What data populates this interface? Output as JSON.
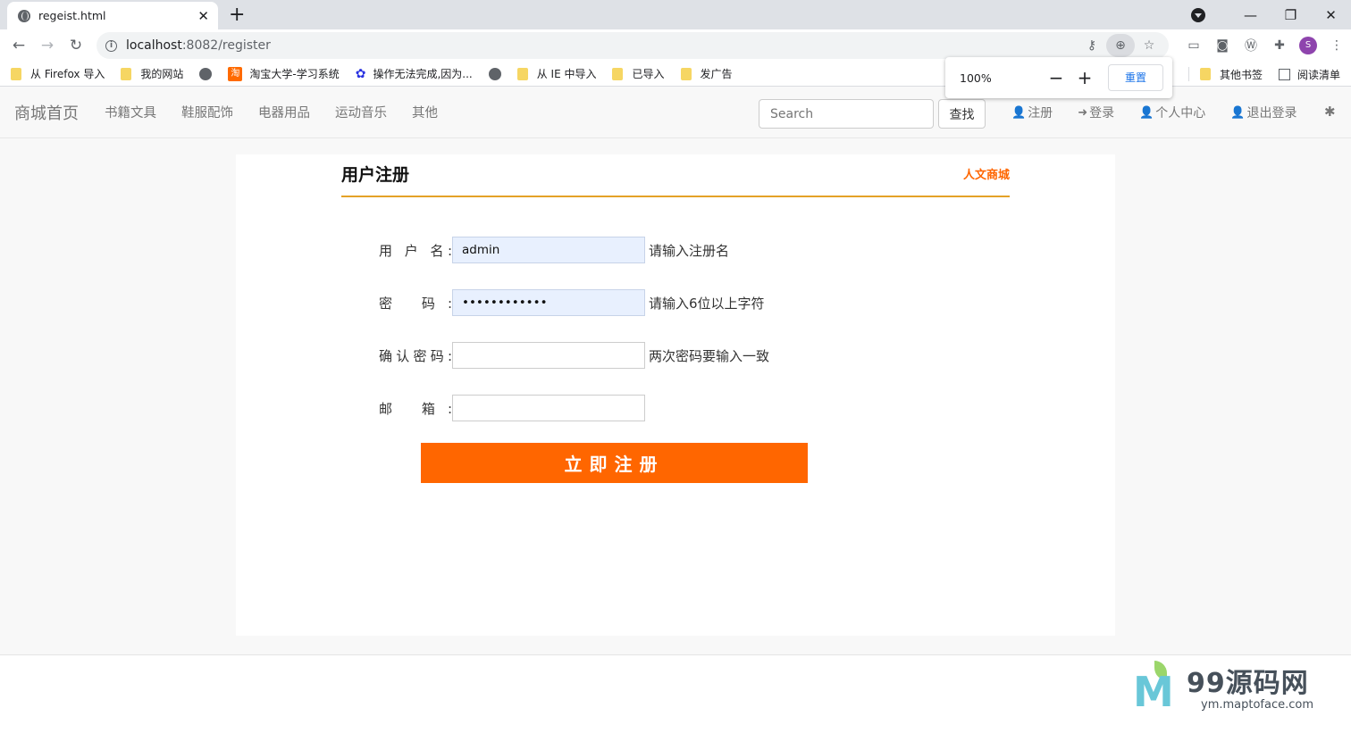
{
  "browser": {
    "tab_title": "regeist.html",
    "url_host": "localhost",
    "url_path": ":8082/register",
    "bookmarks": [
      "从 Firefox 导入",
      "我的网站",
      "",
      "淘宝大学-学习系统",
      "操作无法完成,因为...",
      "",
      "从 IE 中导入",
      "已导入",
      "发广告"
    ],
    "bookmarks_right": [
      "其他书签",
      "阅读清单"
    ],
    "zoom": {
      "level": "100%",
      "minus": "−",
      "plus": "+",
      "reset": "重置"
    },
    "profile_initial": "S"
  },
  "navbar": {
    "brand": "商城首页",
    "links": [
      "书籍文具",
      "鞋服配饰",
      "电器用品",
      "运动音乐",
      "其他"
    ],
    "search_placeholder": "Search",
    "search_button": "查找",
    "user_links": [
      "注册",
      "登录",
      "个人中心",
      "退出登录"
    ]
  },
  "form": {
    "title": "用户注册",
    "subtitle": "人文商城",
    "rows": [
      {
        "label": "用 户 名:",
        "value": "admin",
        "type": "text",
        "hint": "请输入注册名"
      },
      {
        "label": "密 码:",
        "value": "123456789012",
        "type": "password",
        "hint": "请输入6位以上字符"
      },
      {
        "label": "确认密码:",
        "value": "",
        "type": "password",
        "hint": "两次密码要输入一致"
      },
      {
        "label": "邮 箱:",
        "value": "",
        "type": "text",
        "hint": ""
      }
    ],
    "submit": "立即注册"
  },
  "watermark": {
    "name": "99源码网",
    "url": "ym.maptoface.com"
  },
  "colors": {
    "accent": "#ff6600",
    "underline": "#e4a227"
  }
}
